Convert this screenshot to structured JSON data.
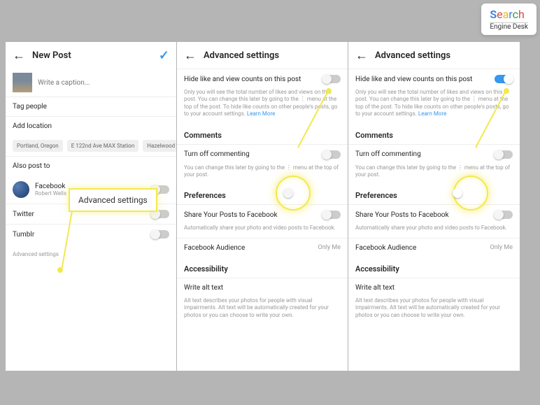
{
  "logo": {
    "brand": "Search",
    "tagline": "Engine Desk"
  },
  "panel1": {
    "title": "New Post",
    "caption_placeholder": "Write a caption...",
    "tag_people": "Tag people",
    "add_location": "Add location",
    "chips": [
      "Portland, Oregon",
      "E 122nd Ave MAX Station",
      "Hazelwood"
    ],
    "also_post": "Also post to",
    "fb": {
      "name": "Facebook",
      "user": "Robert Wells"
    },
    "twitter": "Twitter",
    "tumblr": "Tumblr",
    "advanced": "Advanced settings",
    "highlight": "Advanced settings"
  },
  "adv": {
    "title": "Advanced settings",
    "hide": "Hide like and view counts on this post",
    "hide_sub": "Only you will see the total number of likes and views on this post. You can change this later by going to the ⋮ menu at the top of the post. To hide like counts on other people's posts, go to your account settings.",
    "learn_more": "Learn More",
    "comments": "Comments",
    "turnoff": "Turn off commenting",
    "turnoff_sub": "You can change this later by going to the ⋮ menu at the top of your post.",
    "prefs": "Preferences",
    "share_fb": "Share Your Posts to Facebook",
    "share_sub": "Automatically share your photo and video posts to Facebook.",
    "fb_aud": "Facebook Audience",
    "fb_aud_val": "Only Me",
    "access": "Accessibility",
    "alt": "Write alt text",
    "alt_sub": "Alt text describes your photos for people with visual impairments. Alt text will be automatically created for your photos or you can choose to write your own."
  }
}
